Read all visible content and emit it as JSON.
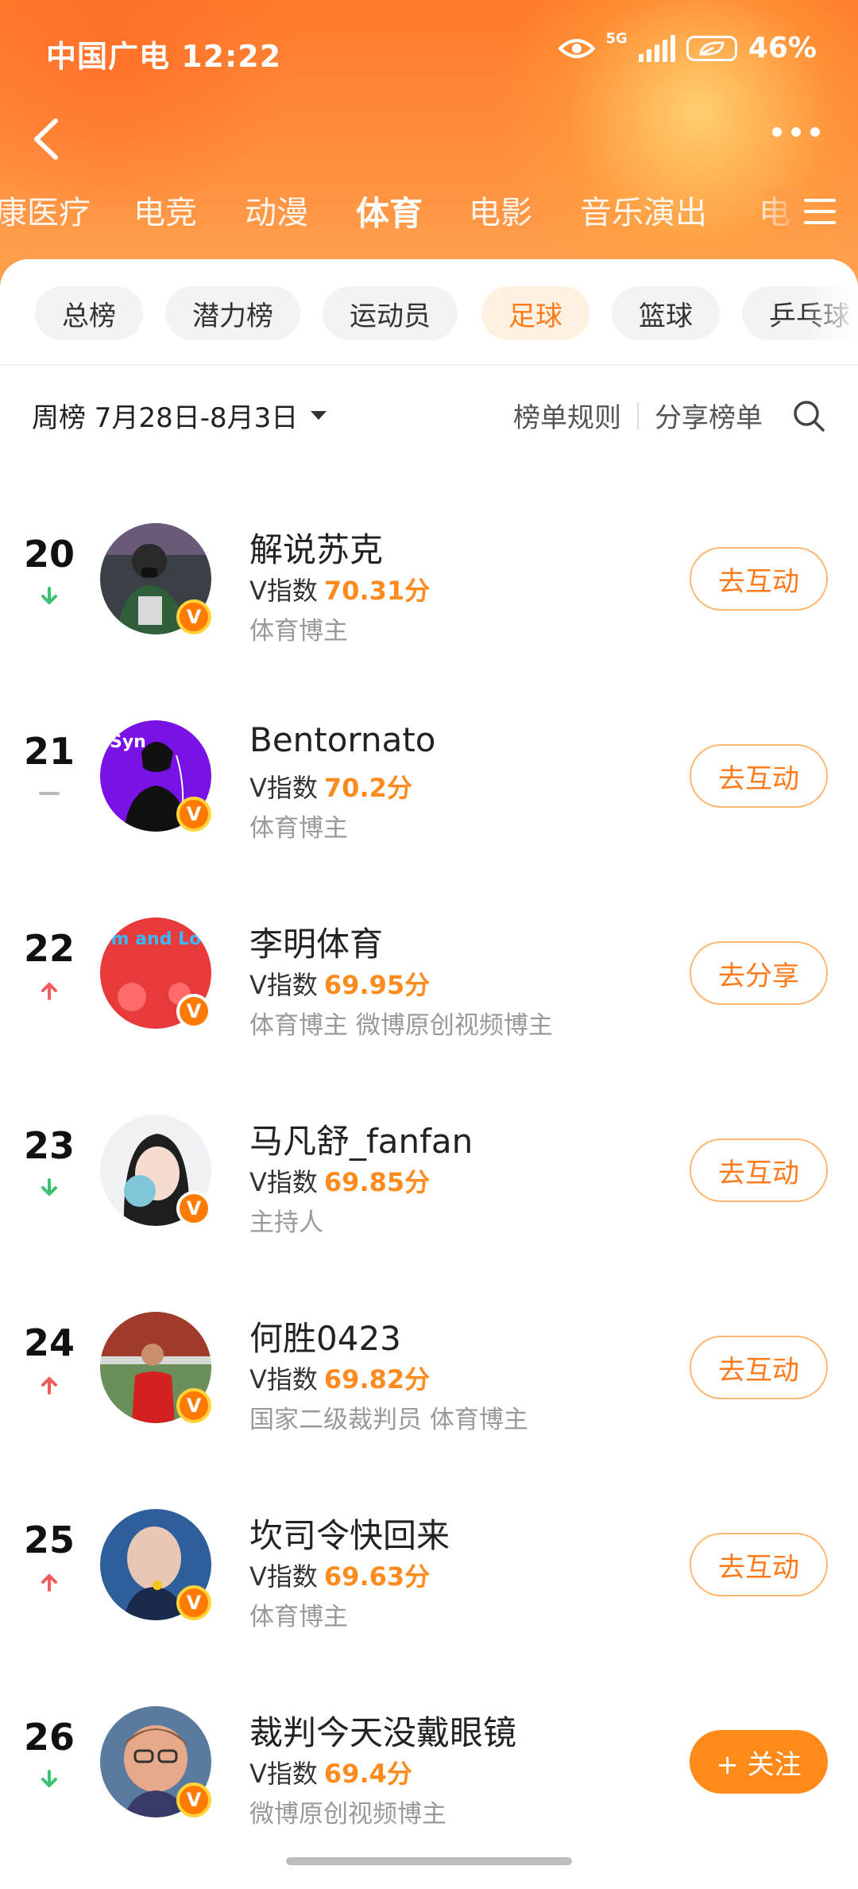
{
  "status_bar": {
    "carrier_time": "中国广电 12:22",
    "network": "5G",
    "battery": "46%"
  },
  "categories": [
    "康医疗",
    "电竞",
    "动漫",
    "体育",
    "电影",
    "音乐演出",
    "电"
  ],
  "active_category": "体育",
  "chips": [
    "总榜",
    "潜力榜",
    "运动员",
    "足球",
    "篮球",
    "乒乓球"
  ],
  "active_chip": "足球",
  "period": "周榜 7月28日-8月3日",
  "links": {
    "rules": "榜单规则",
    "share": "分享榜单"
  },
  "score_label": "V指数",
  "rows": [
    {
      "rank": "20",
      "trend": "down",
      "name": "解说苏克",
      "score": "70.31分",
      "tags": "体育博主",
      "action": "去互动"
    },
    {
      "rank": "21",
      "trend": "same",
      "name": "Bentornato",
      "score": "70.2分",
      "tags": "体育博主",
      "action": "去互动"
    },
    {
      "rank": "22",
      "trend": "up",
      "name": "李明体育",
      "score": "69.95分",
      "tags": "体育博主 微博原创视频博主",
      "action": "去分享"
    },
    {
      "rank": "23",
      "trend": "down",
      "name": "马凡舒_fanfan",
      "score": "69.85分",
      "tags": "主持人",
      "action": "去互动"
    },
    {
      "rank": "24",
      "trend": "up",
      "name": "何胜0423",
      "score": "69.82分",
      "tags": "国家二级裁判员 体育博主",
      "action": "去互动"
    },
    {
      "rank": "25",
      "trend": "up",
      "name": "坎司令快回来",
      "score": "69.63分",
      "tags": "体育博主",
      "action": "去互动"
    },
    {
      "rank": "26",
      "trend": "down",
      "name": "裁判今天没戴眼镜",
      "score": "69.4分",
      "tags": "微博原创视频博主",
      "action": "+ 关注"
    }
  ],
  "avatar_texts": {
    "row21": "Syn",
    "row22": "Keep Calm and Love Footb"
  },
  "colors": {
    "accent": "#ff7a1a",
    "up": "#f25b5b",
    "down": "#3cc371",
    "same": "#bbbbbb"
  }
}
